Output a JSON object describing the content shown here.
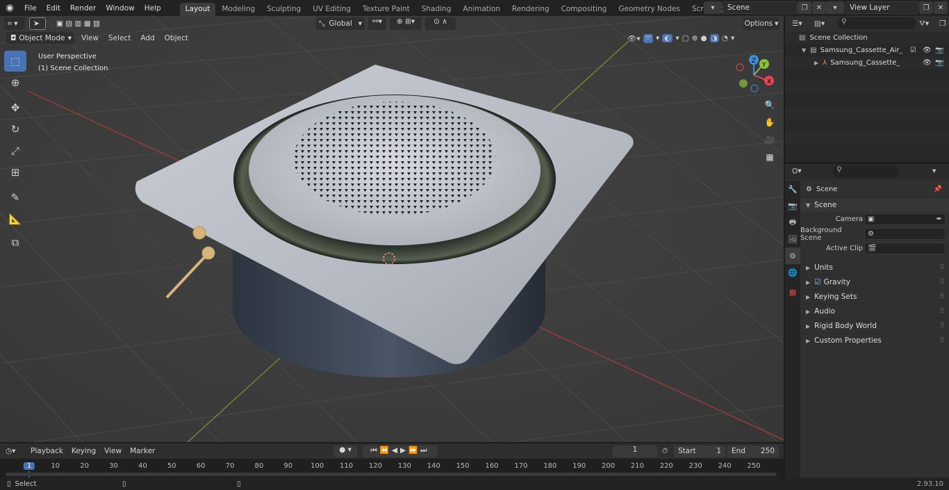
{
  "menu": [
    "File",
    "Edit",
    "Render",
    "Window",
    "Help"
  ],
  "workspaces": [
    "Layout",
    "Modeling",
    "Sculpting",
    "UV Editing",
    "Texture Paint",
    "Shading",
    "Animation",
    "Rendering",
    "Compositing",
    "Geometry Nodes",
    "Scripting"
  ],
  "active_workspace": "Layout",
  "scene_field": "Scene",
  "view_layer_field": "View Layer",
  "viewport": {
    "mode": "Object Mode",
    "menus": [
      "View",
      "Select",
      "Add",
      "Object"
    ],
    "transform_orientation": "Global",
    "options_label": "Options",
    "perspective_label": "User Perspective",
    "collection_label": "(1) Scene Collection",
    "axes": {
      "x": "X",
      "y": "Y",
      "z": "Z"
    }
  },
  "outliner": {
    "root": "Scene Collection",
    "items": [
      "Samsung_Cassette_Air_Cond",
      "Samsung_Cassette_Air_C"
    ]
  },
  "properties": {
    "header": "Scene",
    "section": "Scene",
    "fields": [
      {
        "label": "Camera",
        "value": ""
      },
      {
        "label": "Background Scene",
        "value": ""
      },
      {
        "label": "Active Clip",
        "value": ""
      }
    ],
    "panels": [
      "Units",
      "Gravity",
      "Keying Sets",
      "Audio",
      "Rigid Body World",
      "Custom Properties"
    ]
  },
  "timeline": {
    "menus": [
      "Playback",
      "Keying",
      "View",
      "Marker"
    ],
    "current_frame": "1",
    "start_label": "Start",
    "start": "1",
    "end_label": "End",
    "end": "250",
    "ticks": [
      "1",
      "10",
      "20",
      "30",
      "40",
      "50",
      "60",
      "70",
      "80",
      "90",
      "100",
      "110",
      "120",
      "130",
      "140",
      "150",
      "160",
      "170",
      "180",
      "190",
      "200",
      "210",
      "220",
      "230",
      "240",
      "250"
    ]
  },
  "status": {
    "left": "Select",
    "version": "2.93.10"
  },
  "colors": {
    "accent": "#4772b3",
    "x_axis": "#e44553",
    "y_axis": "#8ac03e",
    "z_axis": "#3d8fd8"
  }
}
